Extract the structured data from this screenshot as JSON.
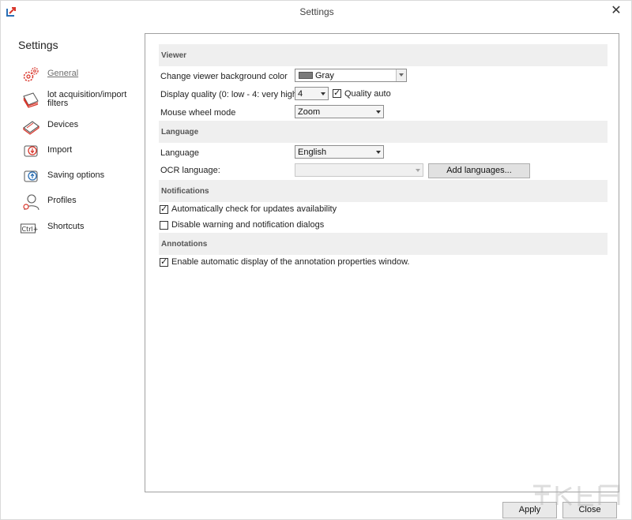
{
  "window": {
    "title": "Settings",
    "close_glyph": "✕"
  },
  "sidebar": {
    "title": "Settings",
    "items": [
      {
        "label": "General",
        "icon": "gears-icon",
        "active": true
      },
      {
        "label": "lot acquisition/import filters",
        "icon": "document-stack-icon",
        "active": false
      },
      {
        "label": "Devices",
        "icon": "scanner-icon",
        "active": false
      },
      {
        "label": "Import",
        "icon": "import-icon",
        "active": false
      },
      {
        "label": "Saving options",
        "icon": "save-icon",
        "active": false
      },
      {
        "label": "Profiles",
        "icon": "user-profile-icon",
        "active": false
      },
      {
        "label": "Shortcuts",
        "icon": "keyboard-shortcut-icon",
        "active": false,
        "icon_text": "Ctrl+"
      }
    ]
  },
  "viewer": {
    "header": "Viewer",
    "bg_color_label": "Change viewer background color",
    "bg_color_value": "Gray",
    "quality_label": "Display quality (0: low - 4: very high)",
    "quality_value": "4",
    "quality_auto_label": "Quality auto",
    "quality_auto_checked": true,
    "mouse_wheel_label": "Mouse wheel mode",
    "mouse_wheel_value": "Zoom"
  },
  "language": {
    "header": "Language",
    "language_label": "Language",
    "language_value": "English",
    "ocr_label": "OCR language:",
    "ocr_value": "",
    "add_languages_button": "Add languages..."
  },
  "notifications": {
    "header": "Notifications",
    "auto_check_label": "Automatically check for updates availability",
    "auto_check_checked": true,
    "disable_warning_label": "Disable warning and notification dialogs",
    "disable_warning_checked": false
  },
  "annotations": {
    "header": "Annotations",
    "auto_display_label": "Enable automatic display of the annotation properties window.",
    "auto_display_checked": true
  },
  "buttons": {
    "apply": "Apply",
    "close": "Close"
  },
  "colors": {
    "accent": "#d9362b",
    "icon_blue": "#2a6fb5",
    "section_bg": "#efefef",
    "swatch_gray": "#7a7a7a"
  }
}
